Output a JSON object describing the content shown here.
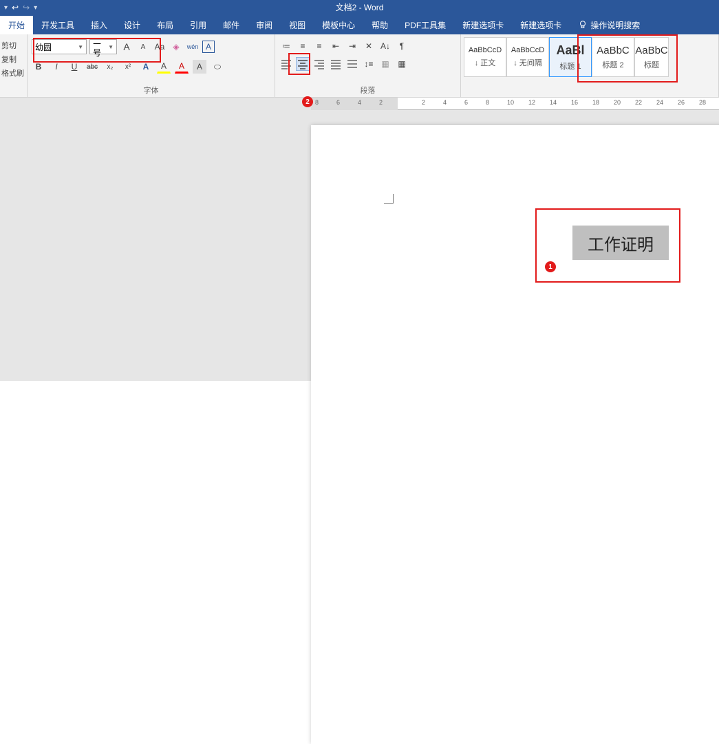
{
  "titlebar": {
    "doc_title": "文档2  -  Word"
  },
  "tabs": {
    "items": [
      "开始",
      "开发工具",
      "插入",
      "设计",
      "布局",
      "引用",
      "邮件",
      "审阅",
      "视图",
      "模板中心",
      "帮助",
      "PDF工具集",
      "新建选项卡",
      "新建选项卡"
    ],
    "tell_me": "操作说明搜索",
    "active_index": 0
  },
  "clipboard": {
    "cut": "剪切",
    "copy": "复制",
    "painter": "格式刷"
  },
  "font": {
    "name": "幼圆",
    "size": "二号",
    "group_label": "字体",
    "btns": {
      "grow": "A",
      "shrink": "A",
      "case": "Aa",
      "clear": "◈",
      "pinyin": "wén",
      "border": "A",
      "bold": "B",
      "italic": "I",
      "underline": "U",
      "strike": "abc",
      "sub": "x₂",
      "sup": "x²",
      "effect": "A",
      "highlight": "A",
      "color": "A",
      "circled": "A",
      "oval": "⬭"
    }
  },
  "paragraph": {
    "group_label": "段落",
    "btns": {
      "bullets": "•",
      "numbers": "1.",
      "multilevel": "≡",
      "dec_indent": "⇤",
      "inc_indent": "⇥",
      "sort": "A↓",
      "marks": "¶",
      "left": "≡",
      "center": "≡",
      "right": "≡",
      "justify": "≡",
      "dist": "≡",
      "linespace": "↕",
      "shade": "▦",
      "borders": "▦"
    }
  },
  "styles": {
    "items": [
      {
        "preview": "AaBbCcD",
        "name": "↓ 正文"
      },
      {
        "preview": "AaBbCcD",
        "name": "↓ 无间隔"
      },
      {
        "preview": "AaBl",
        "name": "标题 1"
      },
      {
        "preview": "AaBbC",
        "name": "标题 2"
      },
      {
        "preview": "AaBbC",
        "name": "标题"
      }
    ],
    "selected_index": 2
  },
  "ruler": {
    "ticks": [
      "8",
      "6",
      "4",
      "2",
      "",
      "2",
      "4",
      "6",
      "8",
      "10",
      "12",
      "14",
      "16",
      "18",
      "20",
      "22",
      "24",
      "26",
      "28"
    ]
  },
  "document": {
    "heading_text": "工作证明"
  },
  "badges": {
    "b1": "1",
    "b2": "2"
  }
}
